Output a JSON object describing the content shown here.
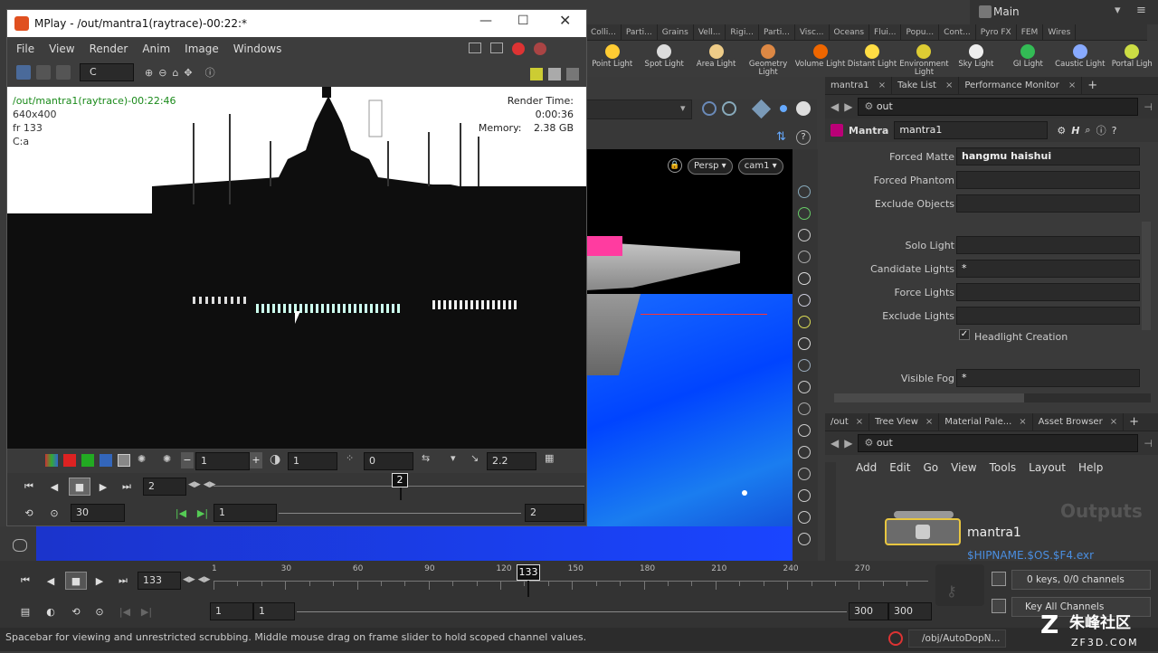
{
  "mplay": {
    "title": "MPlay - /out/mantra1(raytrace)-00:22:*",
    "menu": [
      "File",
      "View",
      "Render",
      "Anim",
      "Image",
      "Windows"
    ],
    "channel": "C",
    "overlay": {
      "name": "/out/mantra1(raytrace)-00:22:46",
      "res": "640x400",
      "frame": "fr 133",
      "channel": "C:a",
      "render_time_label": "Render Time:",
      "render_time": "0:00:36",
      "memory_label": "Memory:",
      "memory": "2.38 GB"
    },
    "controls": {
      "field_a": "1",
      "field_b": "1",
      "field_c": "0",
      "gamma": "2.2",
      "frame_field": "2",
      "frame_marker": "2",
      "fps": "30",
      "range_start": "1",
      "range_end": "2"
    }
  },
  "shelf": {
    "tabs": [
      "Colli...",
      "Parti...",
      "Grains",
      "Vell...",
      "Rigi...",
      "Parti...",
      "Visc...",
      "Oceans",
      "Flui...",
      "Popu...",
      "Cont...",
      "Pyro FX",
      "FEM",
      "Wires"
    ],
    "tools": [
      "Point Light",
      "Spot Light",
      "Area Light",
      "Geometry Light",
      "Volume Light",
      "Distant Light",
      "Environment Light",
      "Sky Light",
      "GI Light",
      "Caustic Light",
      "Portal Ligh"
    ],
    "desktop": "Main"
  },
  "viewport": {
    "persp": "Persp",
    "cam": "cam1"
  },
  "params": {
    "tabs": [
      "mantra1",
      "Take List",
      "Performance Monitor"
    ],
    "path": "out",
    "node_type": "Mantra",
    "node_name": "mantra1",
    "rows": [
      {
        "label": "Forced Matte",
        "value": "hangmu haishui"
      },
      {
        "label": "Forced Phantom",
        "value": ""
      },
      {
        "label": "Exclude Objects",
        "value": ""
      },
      {
        "label": "Solo Light",
        "value": ""
      },
      {
        "label": "Candidate Lights",
        "value": "*"
      },
      {
        "label": "Force Lights",
        "value": ""
      },
      {
        "label": "Exclude Lights",
        "value": ""
      },
      {
        "label": "Visible Fog",
        "value": "*"
      }
    ],
    "headlight": "Headlight Creation"
  },
  "network": {
    "tabs": [
      "/out",
      "Tree View",
      "Material Pale...",
      "Asset Browser"
    ],
    "path": "out",
    "menu": [
      "Add",
      "Edit",
      "Go",
      "View",
      "Tools",
      "Layout",
      "Help"
    ],
    "watermark": "Outputs",
    "node_label": "mantra1",
    "node_expr": "$HIPNAME.$OS.$F4.exr"
  },
  "timeline": {
    "current_frame": "133",
    "marker": "133",
    "ticks": [
      "1",
      "30",
      "60",
      "90",
      "120",
      "150",
      "180",
      "210",
      "240",
      "270"
    ],
    "start": "1",
    "start2": "1",
    "end": "300",
    "end2": "300",
    "keys": "0 keys, 0/0 channels",
    "key_all": "Key All Channels",
    "path": "/obj/AutoDopN...",
    "status": "Spacebar for viewing and unrestricted scrubbing. Middle mouse drag on frame slider to hold scoped channel values.",
    "brand": "朱峰社区",
    "brand_url": "ZF3D.COM"
  }
}
